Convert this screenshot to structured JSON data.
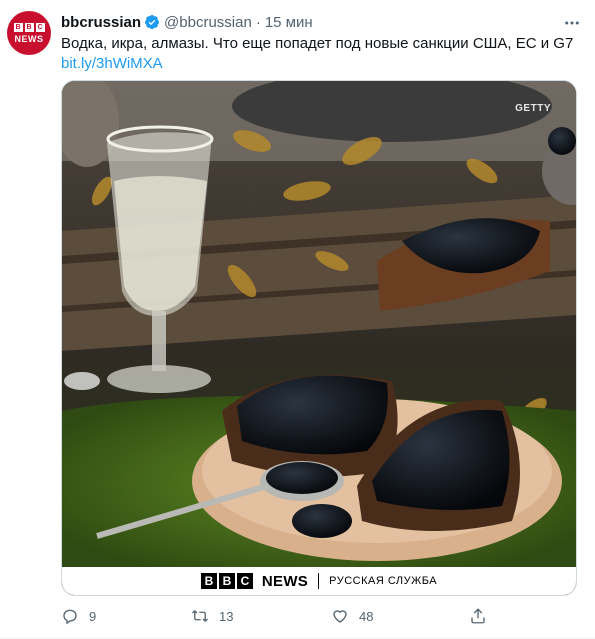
{
  "tweet": {
    "author_name": "bbcrussian",
    "author_handle": "@bbcrussian",
    "separator": "·",
    "time": "15 мин",
    "text": "Водка, икра, алмазы. Что еще попадет под новые санкции США, ЕС и G7",
    "link": "bit.ly/3hWiMXA"
  },
  "avatar": {
    "letters": [
      "B",
      "B",
      "C"
    ],
    "word": "NEWS",
    "color": "#c8102e"
  },
  "media": {
    "credit": "GETTY",
    "banner": {
      "letters": [
        "B",
        "B",
        "C"
      ],
      "news": "NEWS",
      "service": "РУССКАЯ СЛУЖБА"
    },
    "icon": "photo-vodka-caviar"
  },
  "actions": {
    "reply": {
      "icon": "reply-icon",
      "count": "9"
    },
    "retweet": {
      "icon": "retweet-icon",
      "count": "13"
    },
    "like": {
      "icon": "heart-icon",
      "count": "48"
    },
    "share": {
      "icon": "share-icon",
      "count": ""
    }
  },
  "colors": {
    "link": "#1d9bf0",
    "muted": "#536471",
    "verified": "#1d9bf0"
  }
}
